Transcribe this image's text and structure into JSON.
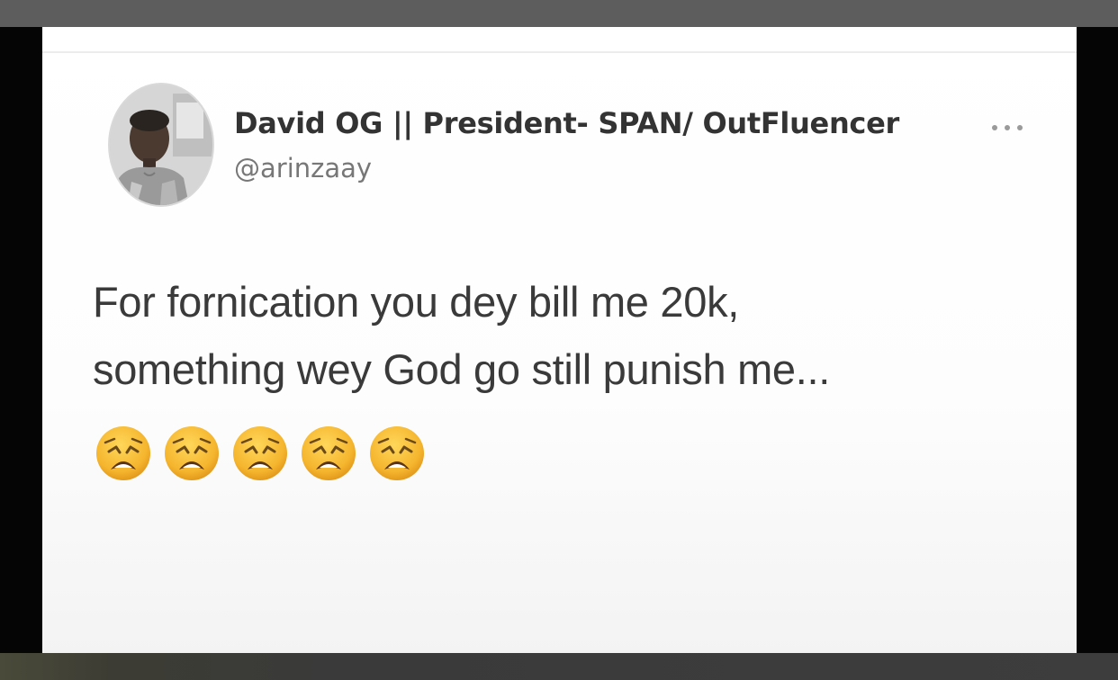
{
  "tweet": {
    "author": {
      "display_name": "David OG || President- SPAN/ OutFluencer",
      "handle": "@arinzaay"
    },
    "menu_icon": "more-horizontal-icon",
    "text_lines": [
      "For fornication you dey bill me 20k,",
      "something wey God go still punish me..."
    ],
    "emojis": [
      "weary-face-icon",
      "weary-face-icon",
      "weary-face-icon",
      "weary-face-icon",
      "weary-face-icon"
    ]
  },
  "colors": {
    "card_background": "#ffffff",
    "name_text": "#333333",
    "handle_text": "#777777",
    "body_text": "#3a3a3a",
    "frame_top": "#5d5d5d",
    "frame_side": "#050505",
    "emoji_yellow": "#f5b52e"
  }
}
